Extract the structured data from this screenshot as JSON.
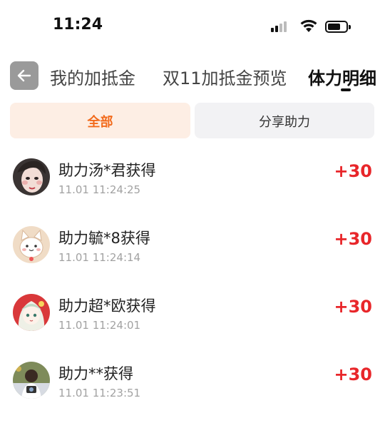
{
  "status_bar": {
    "time": "11:24"
  },
  "tabs": [
    {
      "label": "我的加抵金",
      "active": false
    },
    {
      "label": "双11加抵金预览",
      "active": false
    },
    {
      "label": "体力明细",
      "active": true
    }
  ],
  "filters": [
    {
      "label": "全部",
      "selected": true
    },
    {
      "label": "分享助力",
      "selected": false
    }
  ],
  "records": [
    {
      "title": "助力汤*君获得",
      "time": "11.01 11:24:25",
      "points": "+30"
    },
    {
      "title": "助力毓*8获得",
      "time": "11.01 11:24:14",
      "points": "+30"
    },
    {
      "title": "助力超*欧获得",
      "time": "11.01 11:24:01",
      "points": "+30"
    },
    {
      "title": "助力**获得",
      "time": "11.01 11:23:51",
      "points": "+30"
    }
  ],
  "colors": {
    "accent": "#f26a1b",
    "points": "#e8262a"
  }
}
